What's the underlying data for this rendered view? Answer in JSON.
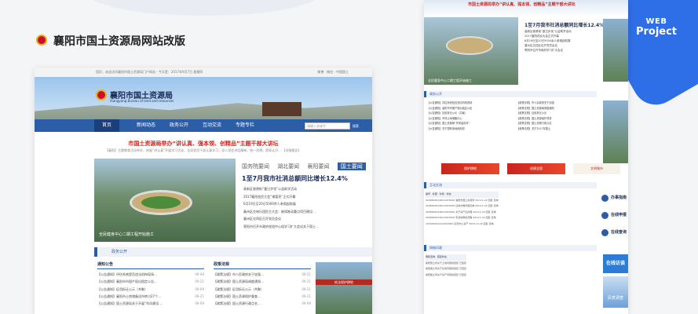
{
  "project_title": "襄阳市国土资源局网站改版",
  "badge": {
    "web": "WEB",
    "project": "Project"
  },
  "main": {
    "topbar_left": "您好，欢迎访问襄阳市国土资源局门户网站 · 今天是：2017年9月7日 星期四",
    "topbar_right": "微博  ·  微信  ·  中国国土",
    "site_title": "襄阳市国土资源局",
    "site_subtitle": "Xiangyang Bureau of land and resources",
    "search_placeholder": "请输入关键字",
    "search_button": "搜索",
    "nav": [
      "首页",
      "新闻动态",
      "政务公开",
      "互动交流",
      "专题专栏"
    ],
    "headline": "市国土资源局举办“讲认真、强本领、创精品”主题干部大讲坛",
    "lead": "【襄阳】主题教育活动举办，依据“讲认真”开展学习活动，全局党员干部认真学习，深入领会讲话精神，统一思想，提高认识…  【详细报告】",
    "photo_caption": "全民健身中心二期工程开始施工",
    "news_tabs": [
      "国务院要闻",
      "湖北要闻",
      "襄阳要闻",
      "国土要闻"
    ],
    "big_news": "1至7月我市社消总额同比增长12.4%",
    "news_list": [
      "高新区香港街“重日步伐”公益助学活动",
      "2017襄阳农民大会“诸葛亮”正式开幕",
      "6月19日至20日5000余人参观起航展",
      "襄州区交响乐团民主大会：继续推动重点项目建设…",
      "襄州区交四区召开党员会议",
      "枣阳市召开市政府党组中心组学习扩大会议关于国土…"
    ],
    "section_title": "政务公开",
    "col1": {
      "header": "通知公告",
      "items": [
        {
          "t": "【公告通知】评估系统是否违法机构现场…",
          "d": "09-09"
        },
        {
          "t": "【公告通知】襄阳市市国产现出租定公告…",
          "d": "09-21"
        },
        {
          "t": "【公告通知】征用拆迁公示（共聚）",
          "d": "09-09"
        },
        {
          "t": "【公告通知】襄阳市土地储备设市转讨27个…",
          "d": "09-21"
        },
        {
          "t": "【公告通知】国土资源局关于开展“作风建设…",
          "d": "09-09"
        }
      ]
    },
    "col2": {
      "header": "政策法规",
      "items": [
        {
          "t": "【政策法规】市人民政府关于加强…",
          "d": "09-21"
        },
        {
          "t": "【政策法规】国土资源局调度通知…",
          "d": "09-21"
        },
        {
          "t": "【政策法规】征用拆迁公示（共聚）",
          "d": "09-21"
        },
        {
          "t": "【政策法规】国土资源保护督查…",
          "d": "09-21"
        },
        {
          "t": "【政策法规】国土资源行政点名…",
          "d": "09-09"
        }
      ]
    },
    "thumb_caption": "依法保护耕地"
  },
  "right": {
    "headline": "市国土资源局举办“讲认真、强本领、创精品”主题干部大讲坛",
    "photo_caption": "全民健身中心二期工程开始施工",
    "big_news": "1至7月我市社消总额同比增长12.4%",
    "news": [
      "高新区香港街“重日步伐”公益助学活动",
      "2017襄阳农民大会正式开幕",
      "6月19日至20日5000余人参观起航展",
      "襄州区交四区召开党员会议",
      "枣阳市召开市政府学习扩大会议"
    ],
    "sec1": "政务公开",
    "col1": [
      "【公告通知】评估系统是否违法机构现场",
      "【公告通知】襄阳市市国产现出租定公告",
      "【公告通知】征用拆迁公示（共聚）",
      "【公告通知】市场土地储备中心",
      "【公告通知】国土资源局“作风建设年”",
      "【公告通知】关于国有用地使用权"
    ],
    "col2": [
      "【政策法规】市人民政府关于加强",
      "【政策法规】国土资源局调度通知",
      "【政策法规】征用拆迁公示",
      "【政策法规】国土资源保护督查",
      "【政策法规】国土资源行政点名",
      "【政策法规】关于2017年国土"
    ],
    "banner1": "保护耕地",
    "banner2": "创建全国",
    "banner3": "文明城市",
    "sec2": "互动交流",
    "table_head": "编号  ·  标题  ·  时间  ·  状态",
    "rows": [
      "42060000146/12015000  襄阳市国土资源局  2014-1-22  回复  咨询",
      "42060000146/12015000  征地补偿问题反映  2014-1-22  回复  咨询",
      "42060000146/12015000  关于房产证办理  2014-1-22  回复  咨询",
      "42060000146/12015000  宅基地审批流程  2014-1-22  回复  咨询",
      "1015000514/12015000  四月市土资产  2015-12-22  回复  咨询"
    ],
    "services": [
      "办事指南",
      "在线申报",
      "在线查询"
    ],
    "sec3": "网络问政",
    "rows2": [
      "网民咨询  ·  回复状态",
      "襄阳国土局关于土地问题的回复  已回复",
      "襄阳国土局关于征地问题的回复  已回复",
      "襄阳国土局关于房产问题的回复  已回复"
    ],
    "online": "在线访谈",
    "interview": "民意调查"
  }
}
